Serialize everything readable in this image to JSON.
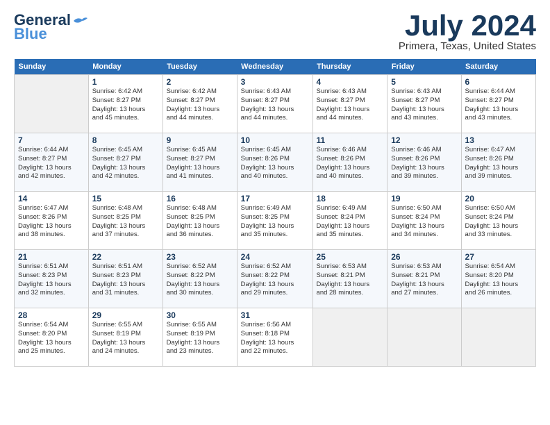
{
  "header": {
    "logo_line1": "General",
    "logo_line2": "Blue",
    "month": "July 2024",
    "location": "Primera, Texas, United States"
  },
  "weekdays": [
    "Sunday",
    "Monday",
    "Tuesday",
    "Wednesday",
    "Thursday",
    "Friday",
    "Saturday"
  ],
  "weeks": [
    [
      {
        "day": "",
        "info": ""
      },
      {
        "day": "1",
        "info": "Sunrise: 6:42 AM\nSunset: 8:27 PM\nDaylight: 13 hours\nand 45 minutes."
      },
      {
        "day": "2",
        "info": "Sunrise: 6:42 AM\nSunset: 8:27 PM\nDaylight: 13 hours\nand 44 minutes."
      },
      {
        "day": "3",
        "info": "Sunrise: 6:43 AM\nSunset: 8:27 PM\nDaylight: 13 hours\nand 44 minutes."
      },
      {
        "day": "4",
        "info": "Sunrise: 6:43 AM\nSunset: 8:27 PM\nDaylight: 13 hours\nand 44 minutes."
      },
      {
        "day": "5",
        "info": "Sunrise: 6:43 AM\nSunset: 8:27 PM\nDaylight: 13 hours\nand 43 minutes."
      },
      {
        "day": "6",
        "info": "Sunrise: 6:44 AM\nSunset: 8:27 PM\nDaylight: 13 hours\nand 43 minutes."
      }
    ],
    [
      {
        "day": "7",
        "info": "Sunrise: 6:44 AM\nSunset: 8:27 PM\nDaylight: 13 hours\nand 42 minutes."
      },
      {
        "day": "8",
        "info": "Sunrise: 6:45 AM\nSunset: 8:27 PM\nDaylight: 13 hours\nand 42 minutes."
      },
      {
        "day": "9",
        "info": "Sunrise: 6:45 AM\nSunset: 8:27 PM\nDaylight: 13 hours\nand 41 minutes."
      },
      {
        "day": "10",
        "info": "Sunrise: 6:45 AM\nSunset: 8:26 PM\nDaylight: 13 hours\nand 40 minutes."
      },
      {
        "day": "11",
        "info": "Sunrise: 6:46 AM\nSunset: 8:26 PM\nDaylight: 13 hours\nand 40 minutes."
      },
      {
        "day": "12",
        "info": "Sunrise: 6:46 AM\nSunset: 8:26 PM\nDaylight: 13 hours\nand 39 minutes."
      },
      {
        "day": "13",
        "info": "Sunrise: 6:47 AM\nSunset: 8:26 PM\nDaylight: 13 hours\nand 39 minutes."
      }
    ],
    [
      {
        "day": "14",
        "info": "Sunrise: 6:47 AM\nSunset: 8:26 PM\nDaylight: 13 hours\nand 38 minutes."
      },
      {
        "day": "15",
        "info": "Sunrise: 6:48 AM\nSunset: 8:25 PM\nDaylight: 13 hours\nand 37 minutes."
      },
      {
        "day": "16",
        "info": "Sunrise: 6:48 AM\nSunset: 8:25 PM\nDaylight: 13 hours\nand 36 minutes."
      },
      {
        "day": "17",
        "info": "Sunrise: 6:49 AM\nSunset: 8:25 PM\nDaylight: 13 hours\nand 35 minutes."
      },
      {
        "day": "18",
        "info": "Sunrise: 6:49 AM\nSunset: 8:24 PM\nDaylight: 13 hours\nand 35 minutes."
      },
      {
        "day": "19",
        "info": "Sunrise: 6:50 AM\nSunset: 8:24 PM\nDaylight: 13 hours\nand 34 minutes."
      },
      {
        "day": "20",
        "info": "Sunrise: 6:50 AM\nSunset: 8:24 PM\nDaylight: 13 hours\nand 33 minutes."
      }
    ],
    [
      {
        "day": "21",
        "info": "Sunrise: 6:51 AM\nSunset: 8:23 PM\nDaylight: 13 hours\nand 32 minutes."
      },
      {
        "day": "22",
        "info": "Sunrise: 6:51 AM\nSunset: 8:23 PM\nDaylight: 13 hours\nand 31 minutes."
      },
      {
        "day": "23",
        "info": "Sunrise: 6:52 AM\nSunset: 8:22 PM\nDaylight: 13 hours\nand 30 minutes."
      },
      {
        "day": "24",
        "info": "Sunrise: 6:52 AM\nSunset: 8:22 PM\nDaylight: 13 hours\nand 29 minutes."
      },
      {
        "day": "25",
        "info": "Sunrise: 6:53 AM\nSunset: 8:21 PM\nDaylight: 13 hours\nand 28 minutes."
      },
      {
        "day": "26",
        "info": "Sunrise: 6:53 AM\nSunset: 8:21 PM\nDaylight: 13 hours\nand 27 minutes."
      },
      {
        "day": "27",
        "info": "Sunrise: 6:54 AM\nSunset: 8:20 PM\nDaylight: 13 hours\nand 26 minutes."
      }
    ],
    [
      {
        "day": "28",
        "info": "Sunrise: 6:54 AM\nSunset: 8:20 PM\nDaylight: 13 hours\nand 25 minutes."
      },
      {
        "day": "29",
        "info": "Sunrise: 6:55 AM\nSunset: 8:19 PM\nDaylight: 13 hours\nand 24 minutes."
      },
      {
        "day": "30",
        "info": "Sunrise: 6:55 AM\nSunset: 8:19 PM\nDaylight: 13 hours\nand 23 minutes."
      },
      {
        "day": "31",
        "info": "Sunrise: 6:56 AM\nSunset: 8:18 PM\nDaylight: 13 hours\nand 22 minutes."
      },
      {
        "day": "",
        "info": ""
      },
      {
        "day": "",
        "info": ""
      },
      {
        "day": "",
        "info": ""
      }
    ]
  ]
}
